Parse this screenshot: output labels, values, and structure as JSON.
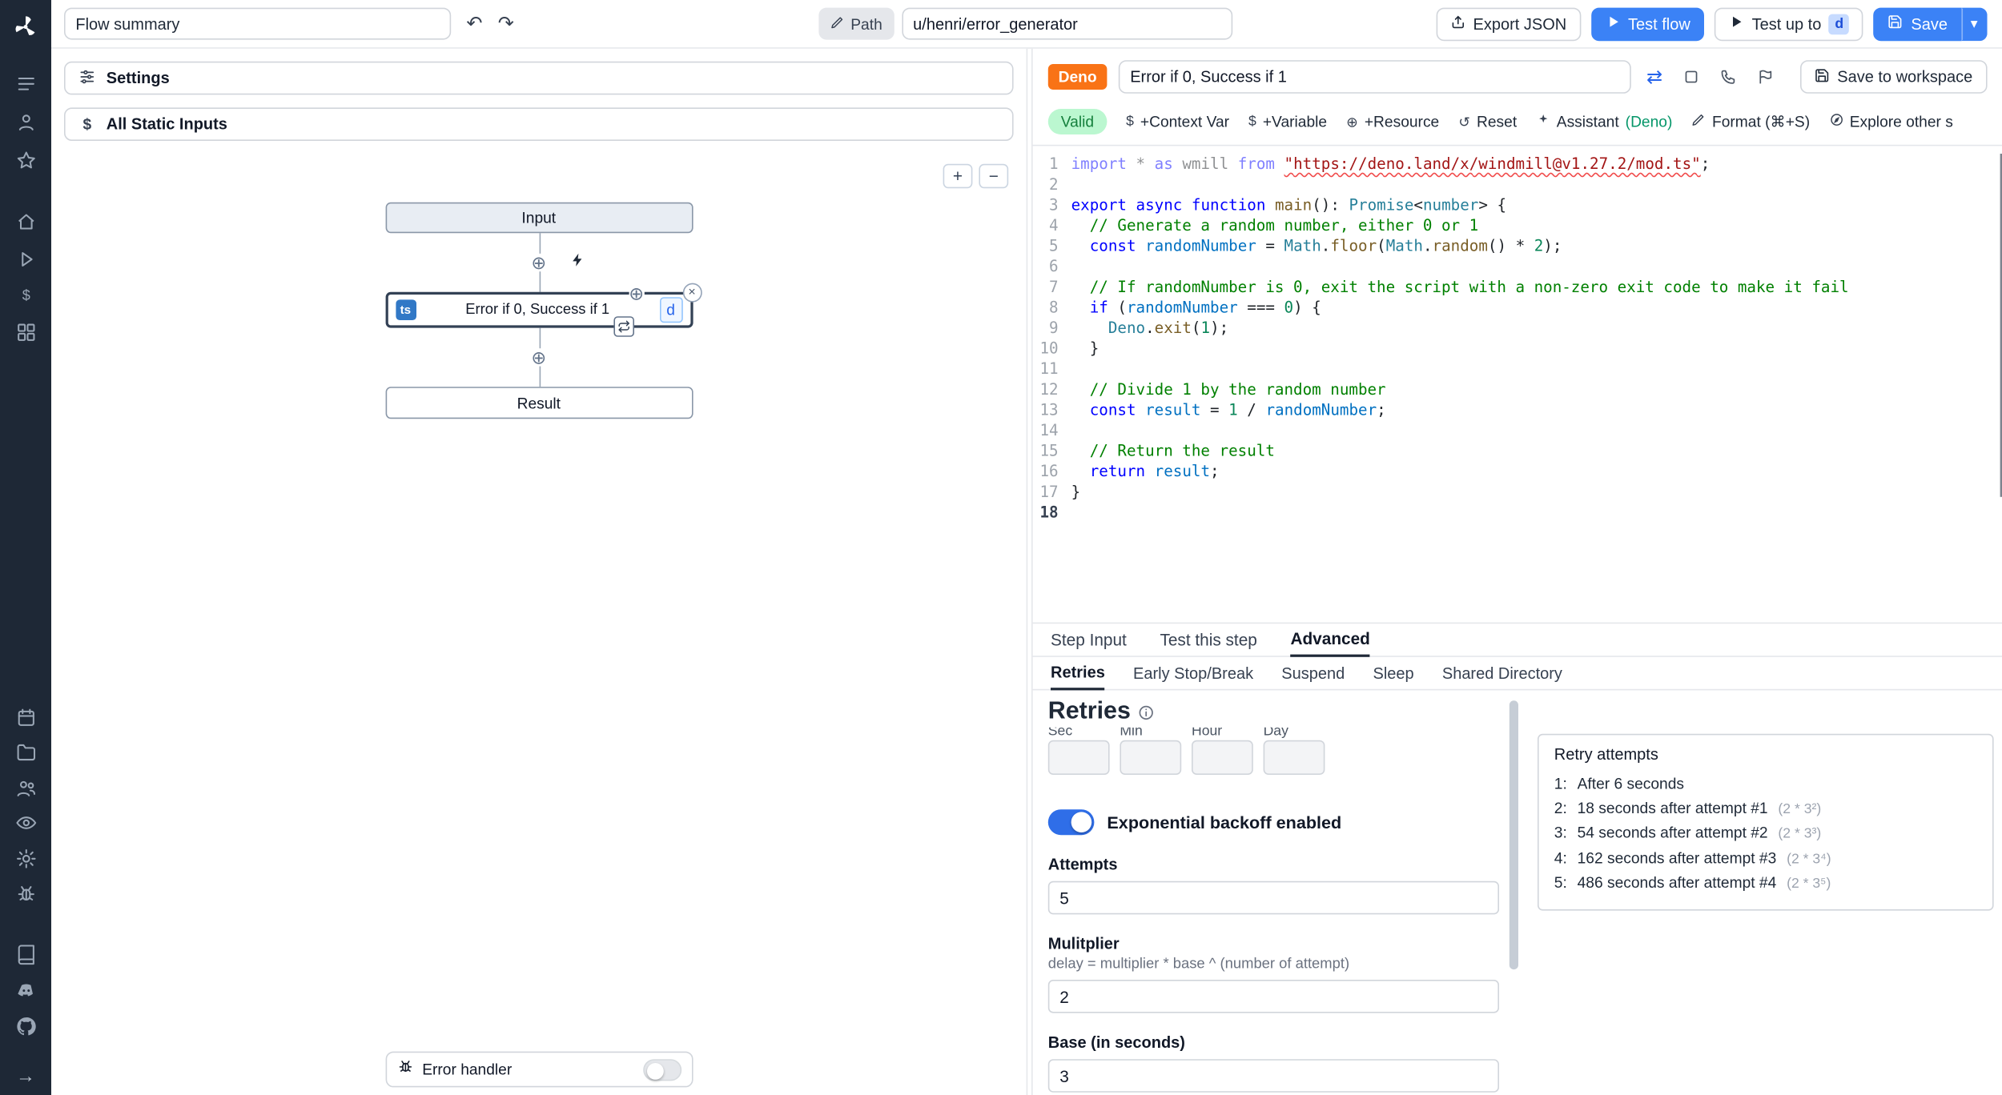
{
  "icons": {
    "undo": "↶",
    "redo": "↷",
    "chevron_down": "▾",
    "plus": "+",
    "minus": "−",
    "close": "×",
    "dollar": "$",
    "circle_plus": "⊕",
    "swap": "⇄",
    "reset": "↺"
  },
  "topbar": {
    "flow_summary": "Flow summary",
    "path_label": "Path",
    "path_value": "u/henri/error_generator",
    "export_json": "Export JSON",
    "test_flow": "Test flow",
    "test_up_to": "Test up to",
    "test_up_to_badge": "d",
    "save": "Save"
  },
  "flow_panel": {
    "settings": "Settings",
    "all_static_inputs": "All Static Inputs",
    "nodes": {
      "input": "Input",
      "step_label": "Error if 0, Success if 1",
      "step_lang_badge": "ts",
      "step_id": "d",
      "result": "Result"
    },
    "error_handler": "Error handler"
  },
  "editor_panel": {
    "lang_badge": "Deno",
    "step_name": "Error if 0, Success if 1",
    "save_to_workspace": "Save to workspace",
    "toolbar": {
      "valid": "Valid",
      "context_var": "+Context Var",
      "variable": "+Variable",
      "resource": "+Resource",
      "reset": "Reset",
      "assistant": "Assistant",
      "assistant_lang": "(Deno)",
      "format": "Format (⌘+S)",
      "explore": "Explore other s"
    },
    "code_lines": [
      [
        [
          "k fd",
          "import"
        ],
        [
          "p fd",
          " * "
        ],
        [
          "k fd",
          "as"
        ],
        [
          "p fd",
          " wmill "
        ],
        [
          "k fd",
          "from"
        ],
        [
          "p fd",
          " "
        ],
        [
          "s sq",
          "\"https://deno.land/x/windmill@v1.27.2/mod.ts\""
        ],
        [
          "p",
          ";"
        ]
      ],
      [],
      [
        [
          "k",
          "export"
        ],
        [
          "p",
          " "
        ],
        [
          "k",
          "async"
        ],
        [
          "p",
          " "
        ],
        [
          "k",
          "function"
        ],
        [
          "p",
          " "
        ],
        [
          "f",
          "main"
        ],
        [
          "p",
          "(): "
        ],
        [
          "t",
          "Promise"
        ],
        [
          "p",
          "<"
        ],
        [
          "t",
          "number"
        ],
        [
          "p",
          "> {"
        ]
      ],
      [
        [
          "c",
          "  // Generate a random number, either 0 or 1"
        ]
      ],
      [
        [
          "p",
          "  "
        ],
        [
          "k",
          "const"
        ],
        [
          "p",
          " "
        ],
        [
          "cv",
          "randomNumber"
        ],
        [
          "p",
          " = "
        ],
        [
          "t",
          "Math"
        ],
        [
          "p",
          "."
        ],
        [
          "f",
          "floor"
        ],
        [
          "p",
          "("
        ],
        [
          "t",
          "Math"
        ],
        [
          "p",
          "."
        ],
        [
          "f",
          "random"
        ],
        [
          "p",
          "() * "
        ],
        [
          "n",
          "2"
        ],
        [
          "p",
          ");"
        ]
      ],
      [],
      [
        [
          "c",
          "  // If randomNumber is 0, exit the script with a non-zero exit code to make it fail"
        ]
      ],
      [
        [
          "p",
          "  "
        ],
        [
          "k",
          "if"
        ],
        [
          "p",
          " ("
        ],
        [
          "cv",
          "randomNumber"
        ],
        [
          "p",
          " === "
        ],
        [
          "n",
          "0"
        ],
        [
          "p",
          ") {"
        ]
      ],
      [
        [
          "p",
          "    "
        ],
        [
          "t",
          "Deno"
        ],
        [
          "p",
          "."
        ],
        [
          "f",
          "exit"
        ],
        [
          "p",
          "("
        ],
        [
          "n",
          "1"
        ],
        [
          "p",
          ");"
        ]
      ],
      [
        [
          "p",
          "  }"
        ]
      ],
      [],
      [
        [
          "c",
          "  // Divide 1 by the random number"
        ]
      ],
      [
        [
          "p",
          "  "
        ],
        [
          "k",
          "const"
        ],
        [
          "p",
          " "
        ],
        [
          "cv",
          "result"
        ],
        [
          "p",
          " = "
        ],
        [
          "n",
          "1"
        ],
        [
          "p",
          " / "
        ],
        [
          "cv",
          "randomNumber"
        ],
        [
          "p",
          ";"
        ]
      ],
      [],
      [
        [
          "c",
          "  // Return the result"
        ]
      ],
      [
        [
          "p",
          "  "
        ],
        [
          "k",
          "return"
        ],
        [
          "p",
          " "
        ],
        [
          "cv",
          "result"
        ],
        [
          "p",
          ";"
        ]
      ],
      [
        [
          "p",
          "}"
        ]
      ],
      []
    ]
  },
  "tabs": {
    "items": [
      "Step Input",
      "Test this step",
      "Advanced"
    ]
  },
  "subtabs": {
    "items": [
      "Retries",
      "Early Stop/Break",
      "Suspend",
      "Sleep",
      "Shared Directory"
    ]
  },
  "retries": {
    "heading": "Retries",
    "time_labels": [
      "Sec",
      "Min",
      "Hour",
      "Day"
    ],
    "backoff_toggle_label": "Exponential backoff enabled",
    "attempts_label": "Attempts",
    "attempts_value": "5",
    "multiplier_label": "Mulitplier",
    "multiplier_help": "delay = multiplier * base ^ (number of attempt)",
    "multiplier_value": "2",
    "base_label": "Base (in seconds)",
    "base_value": "3",
    "retry_box": {
      "title": "Retry attempts",
      "items": [
        {
          "n": "1:",
          "text": "After 6 seconds",
          "formula": ""
        },
        {
          "n": "2:",
          "text": "18 seconds after attempt #1",
          "formula": "(2 * 3²)"
        },
        {
          "n": "3:",
          "text": "54 seconds after attempt #2",
          "formula": "(2 * 3³)"
        },
        {
          "n": "4:",
          "text": "162 seconds after attempt #3",
          "formula": "(2 * 3⁴)"
        },
        {
          "n": "5:",
          "text": "486 seconds after attempt #4",
          "formula": "(2 * 3⁵)"
        }
      ]
    }
  }
}
